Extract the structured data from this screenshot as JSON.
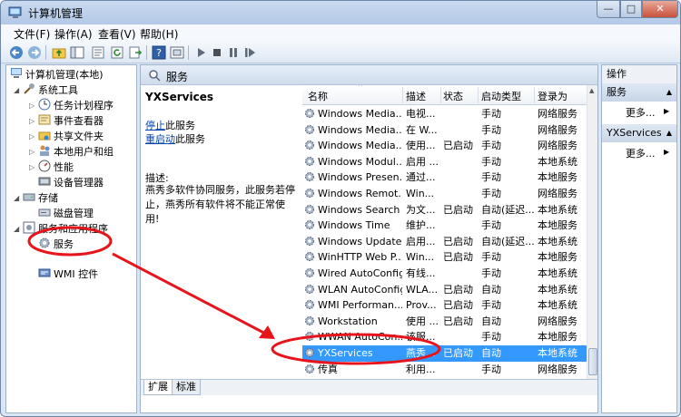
{
  "window": {
    "title": "计算机管理",
    "controls": {
      "minimize": "—",
      "maximize": "□",
      "close": "✕"
    }
  },
  "menubar": [
    {
      "label": "文件(F)"
    },
    {
      "label": "操作(A)"
    },
    {
      "label": "查看(V)"
    },
    {
      "label": "帮助(H)"
    }
  ],
  "toolbar": {
    "icons": [
      "back-arrow-icon",
      "forward-arrow-icon",
      "up-folder-icon",
      "show-hide-tree-icon",
      "properties-icon",
      "refresh-icon",
      "export-icon",
      "help-icon",
      "view-icon",
      "play-icon",
      "stop-icon",
      "pause-icon",
      "restart-icon"
    ]
  },
  "tree": {
    "items": [
      {
        "label": "计算机管理(本地)",
        "icon": "computer-icon"
      },
      {
        "label": "系统工具",
        "icon": "tools-icon"
      },
      {
        "label": "任务计划程序",
        "icon": "clock-icon"
      },
      {
        "label": "事件查看器",
        "icon": "event-viewer-icon"
      },
      {
        "label": "共享文件夹",
        "icon": "shared-folder-icon"
      },
      {
        "label": "本地用户和组",
        "icon": "users-icon"
      },
      {
        "label": "性能",
        "icon": "performance-icon"
      },
      {
        "label": "设备管理器",
        "icon": "device-manager-icon"
      },
      {
        "label": "存储",
        "icon": "storage-icon"
      },
      {
        "label": "磁盘管理",
        "icon": "disk-icon"
      },
      {
        "label": "服务和应用程序",
        "icon": "services-apps-icon"
      },
      {
        "label": "服务",
        "icon": "gear-icon"
      },
      {
        "label": "WMI 控件",
        "icon": "wmi-icon"
      }
    ]
  },
  "middle": {
    "header": "服务",
    "detail": {
      "title": "YXServices",
      "stop_link": "停止",
      "stop_suffix": "此服务",
      "restart_link": "重启动",
      "restart_suffix": "此服务",
      "desc_label": "描述:",
      "desc_text": "燕秀多软件协同服务，此服务若停止，燕秀所有软件将不能正常使用!"
    },
    "columns": [
      "名称",
      "描述",
      "状态",
      "启动类型",
      "登录为"
    ],
    "rows": [
      {
        "name": "Windows Media...",
        "desc": "电视...",
        "status": "",
        "start": "手动",
        "logon": "网络服务"
      },
      {
        "name": "Windows Media...",
        "desc": "在 W...",
        "status": "",
        "start": "手动",
        "logon": "网络服务"
      },
      {
        "name": "Windows Media...",
        "desc": "使用...",
        "status": "已启动",
        "start": "手动",
        "logon": "网络服务"
      },
      {
        "name": "Windows Modul...",
        "desc": "启用 ...",
        "status": "",
        "start": "手动",
        "logon": "本地系统"
      },
      {
        "name": "Windows Presen...",
        "desc": "通过...",
        "status": "",
        "start": "手动",
        "logon": "本地服务"
      },
      {
        "name": "Windows Remot...",
        "desc": "Win...",
        "status": "",
        "start": "手动",
        "logon": "网络服务"
      },
      {
        "name": "Windows Search",
        "desc": "为文...",
        "status": "已启动",
        "start": "自动(延迟...",
        "logon": "本地系统"
      },
      {
        "name": "Windows Time",
        "desc": "维护...",
        "status": "",
        "start": "手动",
        "logon": "本地服务"
      },
      {
        "name": "Windows Update",
        "desc": "启用...",
        "status": "已启动",
        "start": "自动(延迟...",
        "logon": "本地系统"
      },
      {
        "name": "WinHTTP Web P...",
        "desc": "Win...",
        "status": "已启动",
        "start": "手动",
        "logon": "本地服务"
      },
      {
        "name": "Wired AutoConfig",
        "desc": "有线...",
        "status": "",
        "start": "手动",
        "logon": "本地系统"
      },
      {
        "name": "WLAN AutoConfig",
        "desc": "WLA...",
        "status": "已启动",
        "start": "自动",
        "logon": "本地系统"
      },
      {
        "name": "WMI Performan...",
        "desc": "Prov...",
        "status": "已启动",
        "start": "手动",
        "logon": "本地系统"
      },
      {
        "name": "Workstation",
        "desc": "使用 ...",
        "status": "已启动",
        "start": "自动",
        "logon": "网络服务"
      },
      {
        "name": "WWAN AutoCon...",
        "desc": "该服...",
        "status": "",
        "start": "手动",
        "logon": "本地服务"
      },
      {
        "name": "YXServices",
        "desc": "燕秀...",
        "status": "已启动",
        "start": "自动",
        "logon": "本地系统",
        "selected": true
      },
      {
        "name": "传真",
        "desc": "利用...",
        "status": "",
        "start": "手动",
        "logon": "网络服务"
      }
    ],
    "tabs": [
      "扩展",
      "标准"
    ]
  },
  "actions": {
    "header": "操作",
    "sections": [
      {
        "title": "服务",
        "more": "更多..."
      },
      {
        "title": "YXServices",
        "more": "更多..."
      }
    ]
  },
  "colors": {
    "selection": "#3399ff",
    "annotation_red": "#e8141c",
    "link": "#0645ad"
  }
}
